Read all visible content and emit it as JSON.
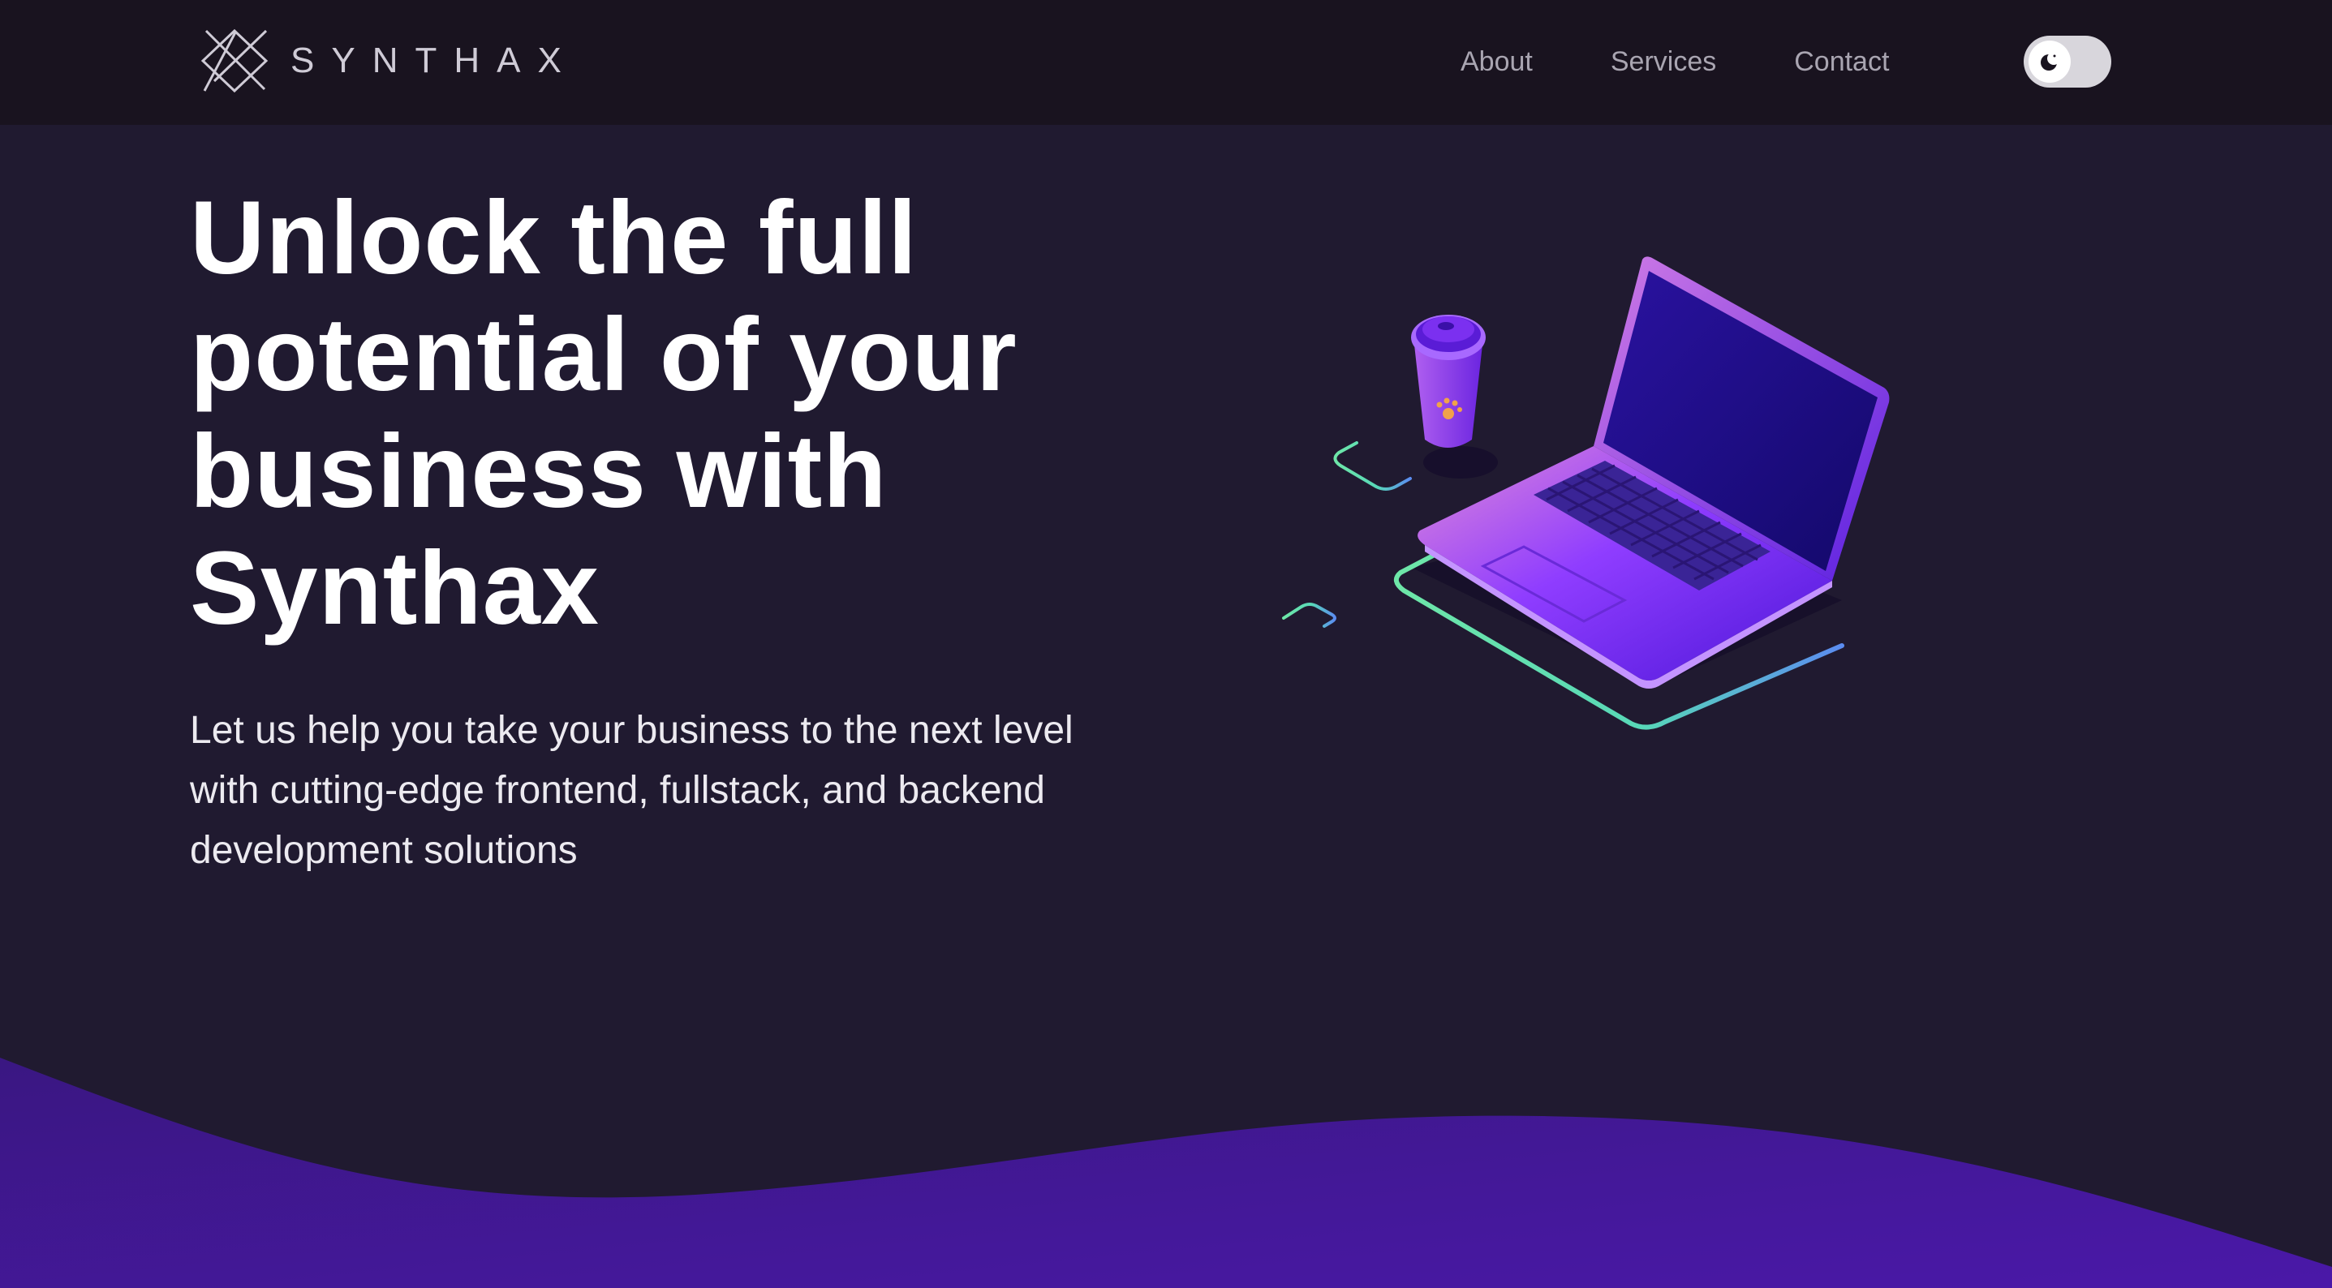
{
  "brand": {
    "name": "SYNTHAX",
    "logo_icon": "synthax-diamond-logo"
  },
  "nav": {
    "links": [
      {
        "label": "About"
      },
      {
        "label": "Services"
      },
      {
        "label": "Contact"
      }
    ],
    "theme_toggle": {
      "icon": "moon-icon",
      "mode": "dark"
    }
  },
  "hero": {
    "title": "Unlock the full potential of your business with Synthax",
    "subtitle": "Let us help you take your business to the next level with cutting-edge frontend, fullstack, and backend development solutions"
  },
  "colors": {
    "page_background": "#201a30",
    "navbar_background": "#19131f",
    "accent_purple": "#7b2cff",
    "wave_purple": "#3a1782",
    "accent_green": "#6ee7a8"
  }
}
